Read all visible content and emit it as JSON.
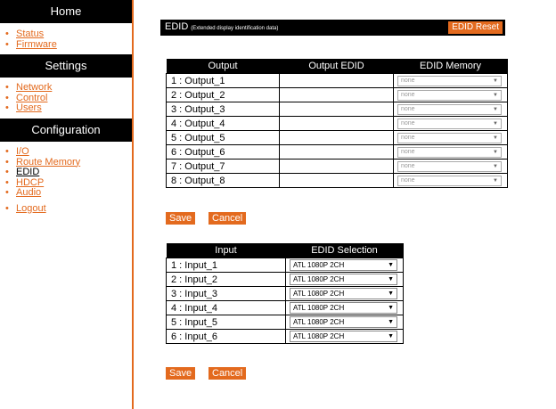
{
  "sidebar": {
    "home": {
      "title": "Home",
      "items": [
        "Status",
        "Firmware"
      ]
    },
    "settings": {
      "title": "Settings",
      "items": [
        "Network",
        "Control",
        "Users"
      ]
    },
    "configuration": {
      "title": "Configuration",
      "items": [
        "I/O",
        "Route Memory",
        "EDID",
        "HDCP",
        "Audio"
      ]
    },
    "logout": "Logout",
    "active_item": "EDID",
    "bullet": "•"
  },
  "header": {
    "title": "EDID",
    "subtitle": "(Extended display identification data)",
    "reset_label": "EDID Reset"
  },
  "outputs": {
    "headers": [
      "Output",
      "Output EDID",
      "EDID Memory"
    ],
    "rows": [
      {
        "name": "1 : Output_1",
        "edid": "",
        "memory": "none"
      },
      {
        "name": "2 : Output_2",
        "edid": "",
        "memory": "none"
      },
      {
        "name": "3 : Output_3",
        "edid": "",
        "memory": "none"
      },
      {
        "name": "4 : Output_4",
        "edid": "",
        "memory": "none"
      },
      {
        "name": "5 : Output_5",
        "edid": "",
        "memory": "none"
      },
      {
        "name": "6 : Output_6",
        "edid": "",
        "memory": "none"
      },
      {
        "name": "7 : Output_7",
        "edid": "",
        "memory": "none"
      },
      {
        "name": "8 : Output_8",
        "edid": "",
        "memory": "none"
      }
    ],
    "save_label": "Save",
    "cancel_label": "Cancel"
  },
  "inputs": {
    "headers": [
      "Input",
      "EDID Selection"
    ],
    "rows": [
      {
        "name": "1 : Input_1",
        "selection": "ATL 1080P 2CH"
      },
      {
        "name": "2 : Input_2",
        "selection": "ATL 1080P 2CH"
      },
      {
        "name": "3 : Input_3",
        "selection": "ATL 1080P 2CH"
      },
      {
        "name": "4 : Input_4",
        "selection": "ATL 1080P 2CH"
      },
      {
        "name": "5 : Input_5",
        "selection": "ATL 1080P 2CH"
      },
      {
        "name": "6 : Input_6",
        "selection": "ATL 1080P 2CH"
      }
    ],
    "save_label": "Save",
    "cancel_label": "Cancel"
  },
  "icons": {
    "dropdown_arrow": "▼"
  },
  "colors": {
    "accent": "#e36a1e",
    "header_bg": "#000000"
  }
}
